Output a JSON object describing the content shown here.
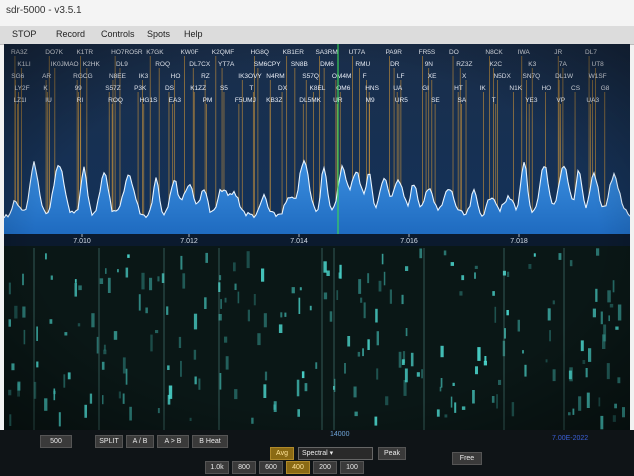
{
  "window": {
    "title": "sdr-5000 - v3.5.1"
  },
  "menu": {
    "items": [
      "STOP",
      "Record",
      "Controls",
      "Spots",
      "Help"
    ]
  },
  "spectrum": {
    "freq_labels": [
      "7.010",
      "7.012",
      "7.014",
      "7.016",
      "7.018"
    ],
    "spot_rows": [
      [
        "RA3Z",
        "DO7K",
        "K1TR",
        "HO7RO5R",
        "K7GK",
        "KW0F",
        "K2QMF",
        "HG8Q",
        "KB1ER",
        "SA3RM",
        "UT7A",
        "PA9R",
        "FR5S",
        "DO",
        "N8CK",
        "IWA",
        "JR",
        "DL7"
      ],
      [
        "K1LI",
        "IK0JMAO",
        "K2HK",
        "DL9",
        "ROQ",
        "DL7CX",
        "YT7A",
        "SM6CPY",
        "SN8B",
        "DM6",
        "RMU",
        "DR",
        "9N",
        "RZ3Z",
        "K2C",
        "K3",
        "7A",
        "UT8"
      ],
      [
        "SG6",
        "AR",
        "RGCG",
        "N8EE",
        "IK3",
        "HO",
        "RZ",
        "IK3OVY",
        "N4RM",
        "S57Q",
        "OM4M",
        "F",
        "LF",
        "XE",
        "X",
        "N5DX",
        "SN7Q",
        "DL1W",
        "W1SF"
      ],
      [
        "LY2F",
        "K",
        "99",
        "S57Z",
        "P3K",
        "DS",
        "K1ZZ",
        "S5",
        "T",
        "DX",
        "K8EL",
        "OM6",
        "HNS",
        "UA",
        "GI",
        "HT",
        "IK",
        "N1K",
        "HO",
        "CS",
        "G8"
      ],
      [
        "LZ1I",
        "IU",
        "RI",
        "ROQ",
        "HG1S",
        "EA3",
        "PM",
        "F5UMJ",
        "KB3Z",
        "DL5MK",
        "UR",
        "M9",
        "UR5",
        "SE",
        "SA",
        "T",
        "YE3",
        "VP",
        "UA3"
      ]
    ]
  },
  "controls": {
    "rit_label": "500",
    "buttons": [
      "SPLIT",
      "A / B",
      "A > B",
      "B Heat"
    ],
    "agc_label": "Avg",
    "agc_mode": "Spectral",
    "peak_label": "Peak",
    "free_label": "Free",
    "center_freq": "14000",
    "bandwidths": [
      "1.0k",
      "800",
      "600",
      "400",
      "200",
      "100"
    ],
    "status_text": "7.00E-2022"
  },
  "colors": {
    "accent": "#2f86d6",
    "waterfall_base": "#0a1716",
    "signal": "#4fe2d8",
    "marker": "#d9a441"
  }
}
